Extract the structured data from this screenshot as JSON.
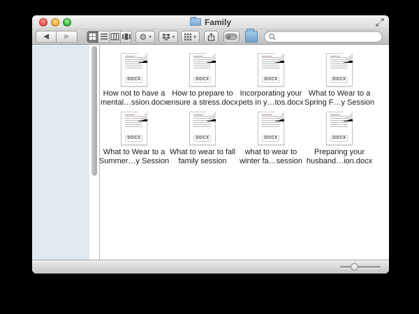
{
  "window": {
    "title": "Family"
  },
  "titlebar": {
    "traffic_lights": [
      "close",
      "minimize",
      "zoom"
    ],
    "fullscreen_icon": "expand-arrows-icon"
  },
  "toolbar": {
    "icons": {
      "back": "◀",
      "forward": "▶",
      "gear": "⚙",
      "dropdown_caret": "▾"
    },
    "buttons": [
      "back",
      "forward",
      "icon-view",
      "list-view",
      "column-view",
      "coverflow-view",
      "action-menu",
      "dropbox-menu",
      "arrange-menu",
      "share",
      "toggle",
      "new-folder",
      "search"
    ]
  },
  "search": {
    "value": "",
    "placeholder": ""
  },
  "sidebar": {
    "items": []
  },
  "files": [
    {
      "line1": "How not to have a",
      "line2": "mental…ssion.docx",
      "badge": "DOCX"
    },
    {
      "line1": "How to prepare to",
      "line2": "ensure a stress.docx",
      "badge": "DOCX"
    },
    {
      "line1": "Incorporating your",
      "line2": "pets in y…tos.docx",
      "badge": "DOCX"
    },
    {
      "line1": "What to Wear to a",
      "line2": "Spring F…y Session",
      "badge": "DOCX"
    },
    {
      "line1": "What to Wear to a",
      "line2": "Summer…y Session",
      "badge": "DOCX"
    },
    {
      "line1": "What to wear to fall",
      "line2": "family session",
      "badge": "DOCX"
    },
    {
      "line1": "what to wear to",
      "line2": "winter fa…session",
      "badge": "DOCX"
    },
    {
      "line1": "Preparing your",
      "line2": "husband…ion.docx",
      "badge": "DOCX"
    }
  ],
  "statusbar": {
    "slider_position_pct": 34
  },
  "colors": {
    "folder_blue": "#7fa9d1",
    "sidebar_bg": "#e2e8f0",
    "traffic_red": "#f05b51",
    "traffic_yellow": "#f6b33e",
    "traffic_green": "#43ba45",
    "selected_segment": "#868686",
    "titlebar_top": "#f4f4f4",
    "toolbar_bottom": "#c0c0c0"
  }
}
